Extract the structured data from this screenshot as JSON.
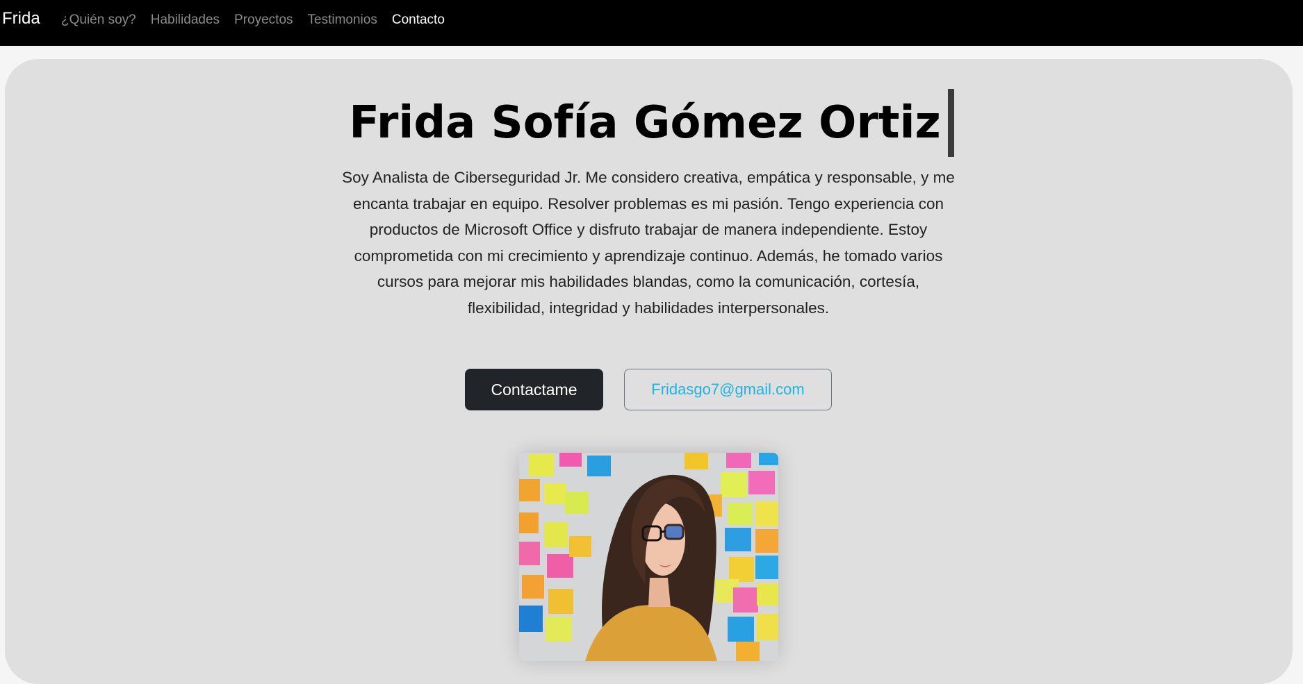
{
  "navbar": {
    "brand": "Frida",
    "links": [
      {
        "label": "¿Quién soy?",
        "active": false
      },
      {
        "label": "Habilidades",
        "active": false
      },
      {
        "label": "Proyectos",
        "active": false
      },
      {
        "label": "Testimonios",
        "active": false
      },
      {
        "label": "Contacto",
        "active": true
      }
    ]
  },
  "hero": {
    "title": "Frida Sofía Gómez Ortiz",
    "intro": "Soy Analista de Ciberseguridad Jr. Me considero creativa, empática y responsable, y me encanta trabajar en equipo. Resolver problemas es mi pasión. Tengo experiencia con productos de Microsoft Office y disfruto trabajar de manera independiente. Estoy comprometida con mi crecimiento y aprendizaje continuo. Además, he tomado varios cursos para mejorar mis habilidades blandas, como la comunicación, cortesía, flexibilidad, integridad y habilidades interpersonales.",
    "contact_button": "Contactame",
    "email_button": "Fridasgo7@gmail.com",
    "photo_icon": "profile-photo"
  },
  "colors": {
    "navbar_bg": "#000000",
    "hero_bg": "#e0dfe0",
    "primary_button": "#212529",
    "email_link": "#1fb4e0"
  }
}
